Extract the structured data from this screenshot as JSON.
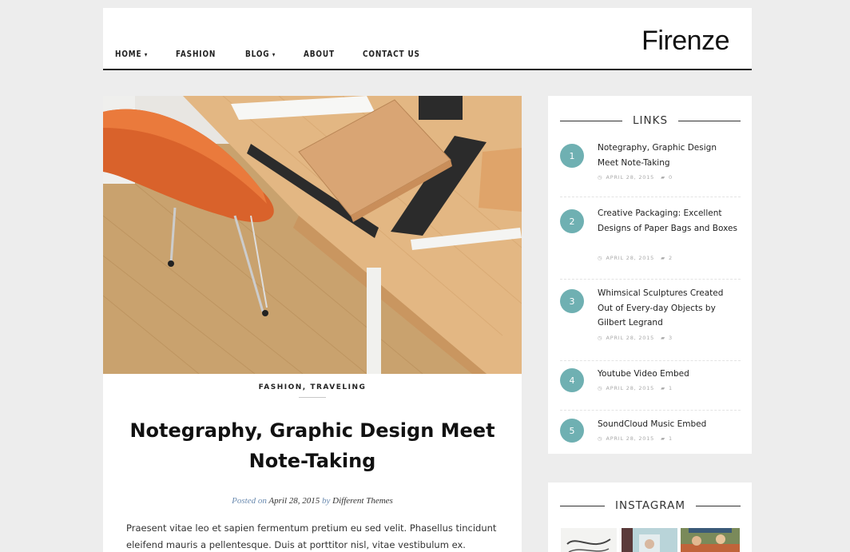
{
  "site": {
    "logo": "Firenze"
  },
  "nav": [
    {
      "label": "HOME",
      "caret": "▾"
    },
    {
      "label": "FASHION",
      "caret": ""
    },
    {
      "label": "BLOG",
      "caret": "▾"
    },
    {
      "label": "ABOUT",
      "caret": ""
    },
    {
      "label": "CONTACT US",
      "caret": ""
    }
  ],
  "post": {
    "categories": "FASHION, TRAVELING",
    "title": "Notegraphy, Graphic Design Meet Note-Taking",
    "meta": {
      "posted_on": "Posted on",
      "date": "April 28, 2015",
      "by": "by",
      "author": "Different Themes"
    },
    "excerpt": "Praesent vitae leo et sapien fermentum pretium eu sed velit. Phasellus tincidunt eleifend mauris a pellentesque. Duis at porttitor nisl, vitae vestibulum ex. Quisque"
  },
  "sidebar": {
    "links": {
      "title": "LINKS",
      "items": [
        {
          "num": "1",
          "title": "Notegraphy, Graphic Design Meet Note-Taking",
          "date": "APRIL 28, 2015",
          "comments": "0"
        },
        {
          "num": "2",
          "title": "Creative Packaging: Excellent Designs of Paper Bags and Boxes",
          "date": "APRIL 28, 2015",
          "comments": "2"
        },
        {
          "num": "3",
          "title": "Whimsical Sculptures Created Out of Every-day Objects by Gilbert Legrand",
          "date": "APRIL 28, 2015",
          "comments": "3"
        },
        {
          "num": "4",
          "title": "Youtube Video Embed",
          "date": "APRIL 28, 2015",
          "comments": "1"
        },
        {
          "num": "5",
          "title": "SoundCloud Music Embed",
          "date": "APRIL 28, 2015",
          "comments": "1"
        }
      ]
    },
    "instagram": {
      "title": "INSTAGRAM"
    }
  },
  "colors": {
    "accent": "#6fb0b2",
    "background": "#ededed",
    "text": "#222222"
  },
  "icons": {
    "clock": "clock-icon",
    "comment": "comment-icon"
  }
}
